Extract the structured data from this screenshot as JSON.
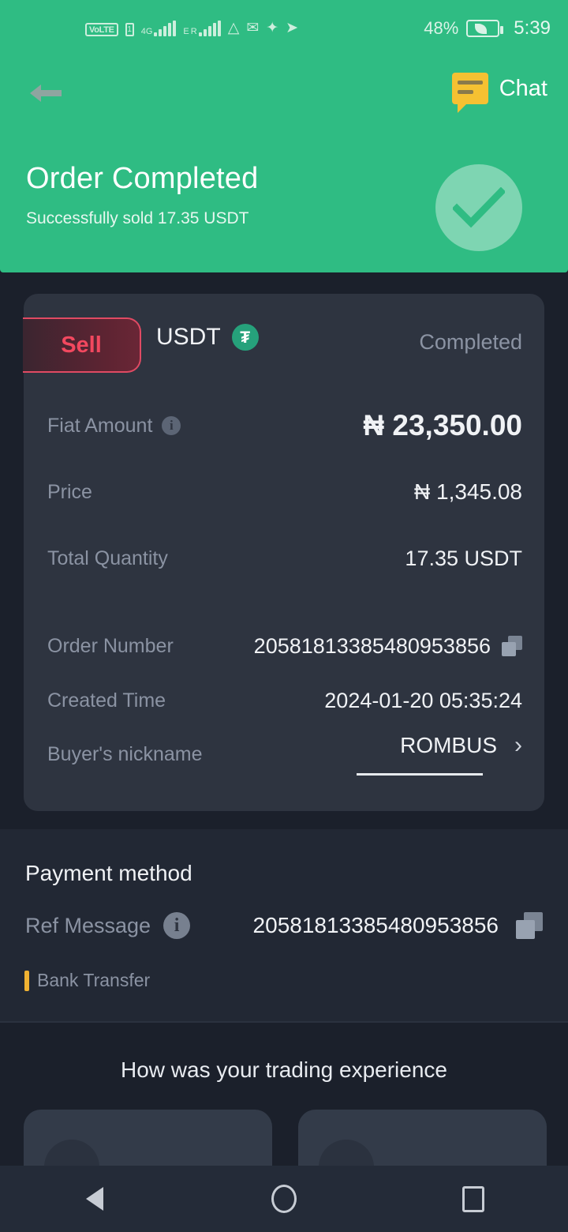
{
  "status_bar": {
    "volte_label": "VoLTE",
    "sim_label": "1",
    "network_type": "4G",
    "network_type2_e": "E",
    "network_type2_r": "R",
    "icons": [
      "volte-icon",
      "sim-icon",
      "signal-4g-icon",
      "signal-roaming-icon",
      "assistant-icon",
      "mail-icon",
      "binance-icon",
      "telegram-icon"
    ],
    "battery_percent": "48%",
    "battery_icon": "battery-eco-icon",
    "time": "5:39"
  },
  "nav": {
    "back_icon": "back-arrow-icon",
    "chat_label": "Chat",
    "chat_icon": "chat-bubble-icon"
  },
  "hero": {
    "title": "Order Completed",
    "subtitle": "Successfully sold  17.35 USDT",
    "check_icon": "check-circle-icon"
  },
  "order_card": {
    "side_badge": "Sell",
    "asset": "USDT",
    "asset_icon": "tether-icon",
    "asset_symbol": "₮",
    "status": "Completed",
    "rows": [
      {
        "label": "Fiat Amount",
        "value": "₦ 23,350.00",
        "info": true
      },
      {
        "label": "Price",
        "value": "₦ 1,345.08",
        "info": false
      },
      {
        "label": "Total Quantity",
        "value": "17.35 USDT",
        "info": false
      },
      {
        "label": "Order Number",
        "value": "20581813385480953856",
        "copy": true
      },
      {
        "label": "Created Time",
        "value": "2024-01-20 05:35:24",
        "copy": false
      },
      {
        "label": "Buyer's nickname",
        "value": "ROMBUS",
        "chevron": true
      }
    ]
  },
  "payment": {
    "title": "Payment method",
    "ref_label": "Ref Message",
    "ref_value": "20581813385480953856",
    "bank_label": "Bank Transfer",
    "copy_icon": "copy-icon",
    "info_icon": "info-icon"
  },
  "experience": {
    "title": "How was your trading experience"
  },
  "system_nav": {
    "back": "back-triangle-icon",
    "home": "home-circle-icon",
    "recents": "recents-square-icon"
  },
  "colors": {
    "brand_green": "#2fbc83",
    "page_bg": "#1b202b",
    "card_bg": "#2e3440",
    "sell_red": "#f2485f",
    "tether_green": "#26a17b",
    "chat_yellow": "#f5c132",
    "bank_amber": "#f0b232"
  }
}
